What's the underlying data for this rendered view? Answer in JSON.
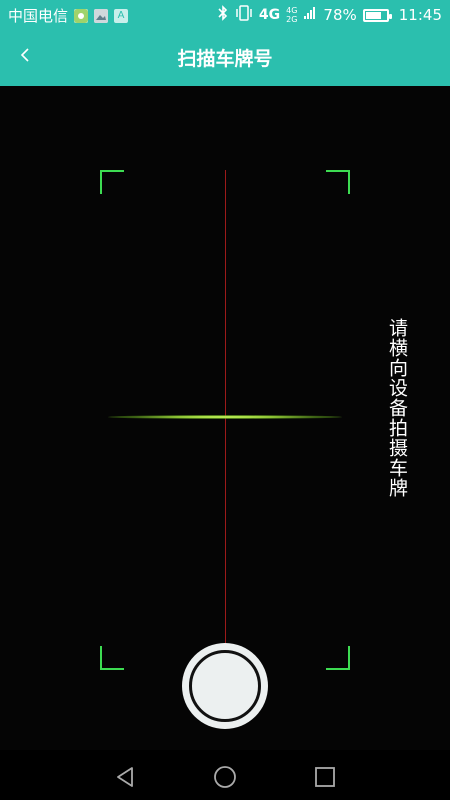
{
  "status_bar": {
    "carrier": "中国电信",
    "app_icons": [
      "chat-icon",
      "gallery-icon",
      "a-icon"
    ],
    "app_icon_a_label": "A",
    "network": "4G",
    "network2": "4G",
    "network3": "2G",
    "battery_percent_text": "78%",
    "battery_level": 78,
    "time": "11:45"
  },
  "header": {
    "title": "扫描车牌号",
    "back_icon": "chevron-left-icon"
  },
  "scanner": {
    "hint": "请横向设备拍摄车牌",
    "frame_color": "#3ddc52",
    "center_line_color": "#9c1a1a",
    "scan_line_color": "#b4e84a"
  },
  "nav_bar": {
    "icons": [
      "back-triangle-icon",
      "home-circle-icon",
      "recent-square-icon"
    ]
  },
  "colors": {
    "header_bg": "#2bbfae",
    "shutter": "#ecf0f0"
  }
}
